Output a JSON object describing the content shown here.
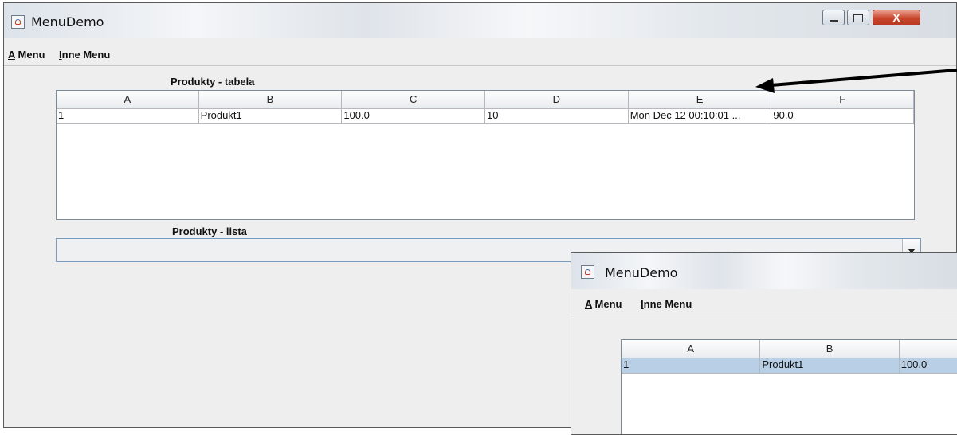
{
  "window": {
    "title": "MenuDemo",
    "menus": [
      "A Menu",
      "Inne Menu"
    ],
    "minimize_icon": "minimize-icon",
    "maximize_icon": "maximize-icon",
    "close_label": "X"
  },
  "table_section": {
    "caption": "Produkty - tabela",
    "columns": [
      "A",
      "B",
      "C",
      "D",
      "E",
      "F"
    ],
    "rows": [
      [
        "1",
        "Produkt1",
        "100.0",
        "10",
        "Mon Dec 12 00:10:01 ...",
        "90.0"
      ]
    ]
  },
  "list_section": {
    "caption": "Produkty - lista",
    "selected": ""
  },
  "overlay_window": {
    "title": "MenuDemo",
    "menus": [
      "A Menu",
      "Inne Menu"
    ],
    "columns": [
      "A",
      "B"
    ],
    "rows": [
      [
        "1",
        "Produkt1",
        "100.0"
      ]
    ],
    "selected_row_color": "#b8cfe5"
  },
  "annotation": {
    "arrow_color": "#000000"
  }
}
